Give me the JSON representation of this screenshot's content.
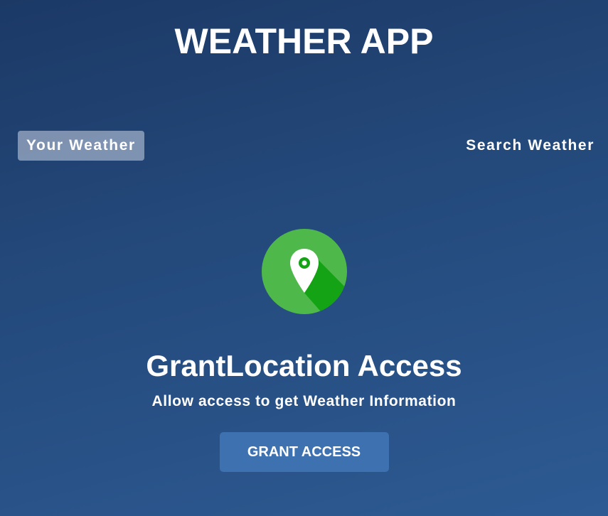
{
  "header": {
    "title": "WEATHER APP"
  },
  "tabs": [
    {
      "label": "Your Weather",
      "active": true
    },
    {
      "label": "Search Weather",
      "active": false
    }
  ],
  "grant": {
    "icon": "location-pin-icon",
    "title": "GrantLocation Access",
    "subtitle": "Allow access to get Weather Information",
    "button_label": "GRANT ACCESS"
  },
  "colors": {
    "background_top": "#1c3966",
    "background_bottom": "#2d5a93",
    "active_tab": "#8797b3",
    "icon_circle": "#4fb84a",
    "icon_shadow": "#14a314",
    "button": "#3d71b0"
  }
}
